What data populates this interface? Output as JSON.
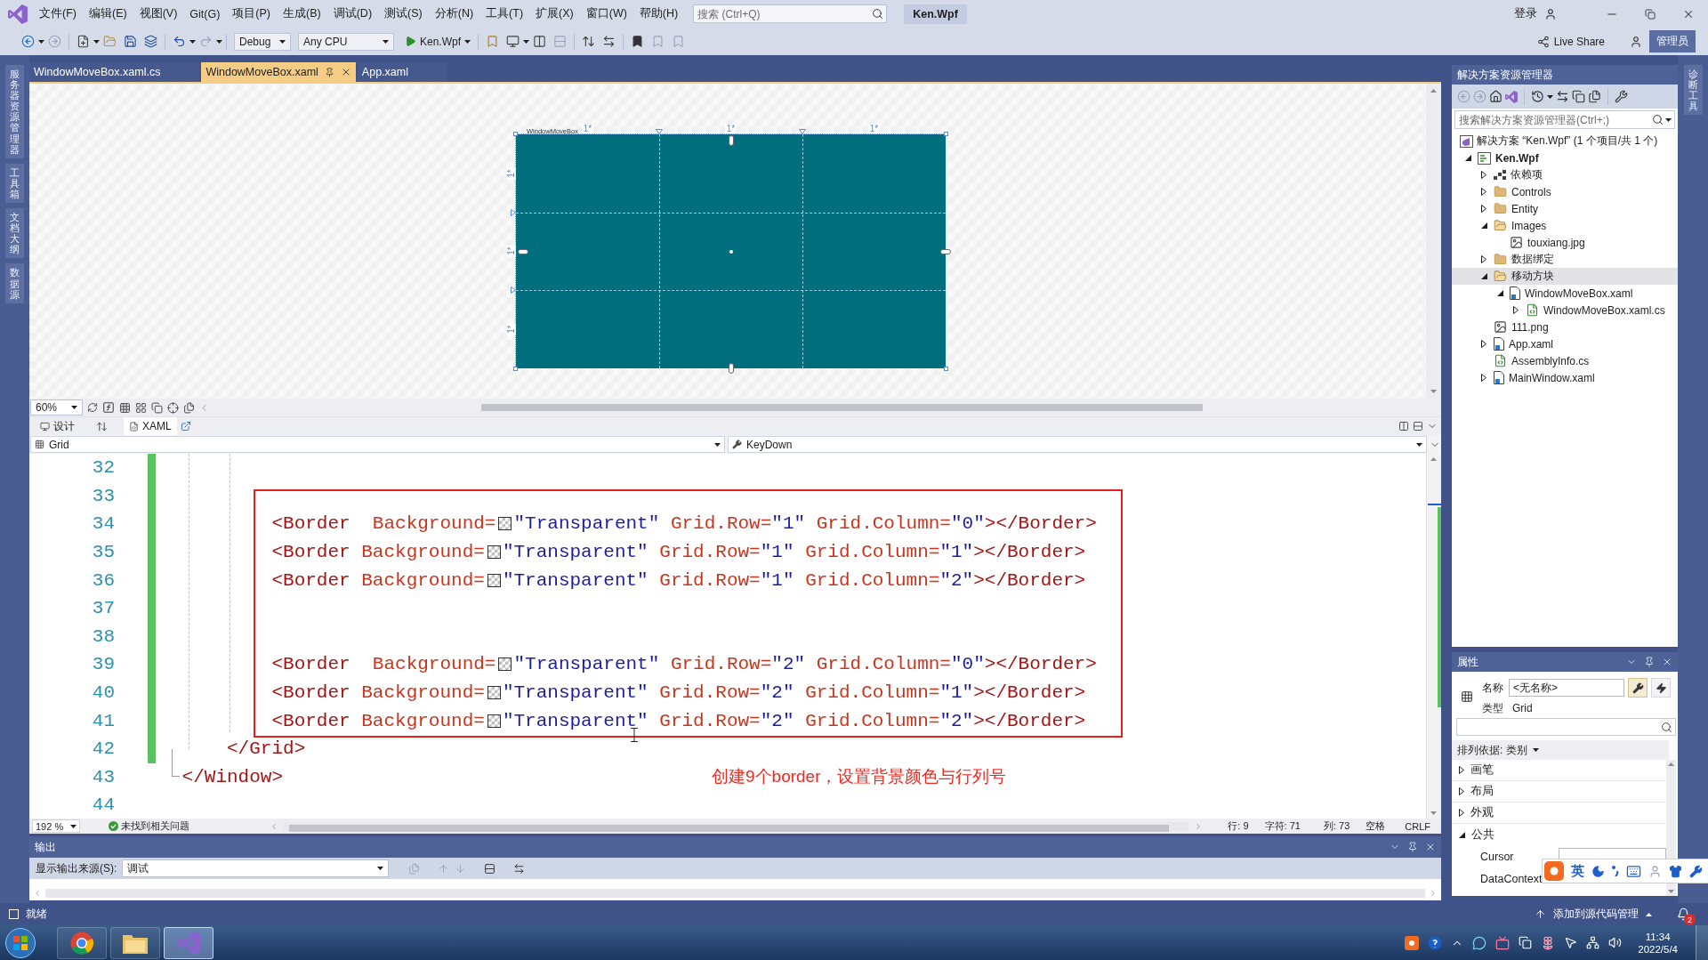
{
  "title_bar": {
    "menus": [
      "文件(F)",
      "编辑(E)",
      "视图(V)",
      "Git(G)",
      "项目(P)",
      "生成(B)",
      "调试(D)",
      "测试(S)",
      "分析(N)",
      "工具(T)",
      "扩展(X)",
      "窗口(W)",
      "帮助(H)"
    ],
    "search": {
      "placeholder": "搜索 (Ctrl+Q)"
    },
    "solution_name": "Ken.Wpf",
    "account": "登录"
  },
  "toolbar": {
    "configuration": "Debug",
    "platform": "Any CPU",
    "start_target": "Ken.Wpf",
    "live_share": "Live Share",
    "role_badge": "管理员"
  },
  "left_tool_tabs": [
    "服务器资源管理器",
    "工具箱",
    "文档大纲",
    "数据源"
  ],
  "right_tool_tabs": [
    "诊断工具"
  ],
  "document_tabs": [
    {
      "label": "WindowMoveBox.xaml.cs",
      "selected": false
    },
    {
      "label": "WindowMoveBox.xaml",
      "selected": true
    },
    {
      "label": "App.xaml",
      "selected": false
    }
  ],
  "designer": {
    "window_label": "WindowMoveBox",
    "columns": [
      "1*",
      "1*",
      "1*"
    ],
    "rows": [
      "1*",
      "1*",
      "1*"
    ],
    "zoom": "60%"
  },
  "view_tabs": [
    {
      "label": "设计",
      "selected": false
    },
    {
      "label": "XAML",
      "selected": true
    }
  ],
  "navigation": {
    "element": "Grid",
    "member": "KeyDown"
  },
  "editor": {
    "blocks": [
      {
        "kind": "changed",
        "children": [
          {
            "kind": "line",
            "number": "32"
          },
          {
            "kind": "line",
            "number": "33"
          },
          {
            "kind": "framed",
            "children": [
              {
                "kind": "line",
                "number": "34",
                "tokens": [
                  {
                    "kind": "tag",
                    "text": "         <Border"
                  },
                  {
                    "kind": "attr",
                    "text": "  Background="
                  },
                  {
                    "kind": "swatch"
                  },
                  {
                    "kind": "value",
                    "text": "\"Transparent\""
                  },
                  {
                    "kind": "attr",
                    "text": " Grid.Row="
                  },
                  {
                    "kind": "value",
                    "text": "\"1\""
                  },
                  {
                    "kind": "attr",
                    "text": " Grid.Column="
                  },
                  {
                    "kind": "value",
                    "text": "\"0\""
                  },
                  {
                    "kind": "tag",
                    "text": "></Border>"
                  }
                ]
              },
              {
                "kind": "line",
                "number": "35",
                "tokens": [
                  {
                    "kind": "tag",
                    "text": "         <Border"
                  },
                  {
                    "kind": "attr",
                    "text": " Background="
                  },
                  {
                    "kind": "swatch"
                  },
                  {
                    "kind": "value",
                    "text": "\"Transparent\""
                  },
                  {
                    "kind": "attr",
                    "text": " Grid.Row="
                  },
                  {
                    "kind": "value",
                    "text": "\"1\""
                  },
                  {
                    "kind": "attr",
                    "text": " Grid.Column="
                  },
                  {
                    "kind": "value",
                    "text": "\"1\""
                  },
                  {
                    "kind": "tag",
                    "text": "></Border>"
                  }
                ]
              },
              {
                "kind": "line",
                "number": "36",
                "tokens": [
                  {
                    "kind": "tag",
                    "text": "         <Border"
                  },
                  {
                    "kind": "attr",
                    "text": " Background="
                  },
                  {
                    "kind": "swatch"
                  },
                  {
                    "kind": "value",
                    "text": "\"Transparent\""
                  },
                  {
                    "kind": "attr",
                    "text": " Grid.Row="
                  },
                  {
                    "kind": "value",
                    "text": "\"1\""
                  },
                  {
                    "kind": "attr",
                    "text": " Grid.Column="
                  },
                  {
                    "kind": "value",
                    "text": "\"2\""
                  },
                  {
                    "kind": "tag",
                    "text": "></Border>"
                  }
                ]
              },
              {
                "kind": "line",
                "number": "37"
              },
              {
                "kind": "line",
                "number": "38"
              },
              {
                "kind": "line",
                "number": "39",
                "tokens": [
                  {
                    "kind": "tag",
                    "text": "         <Border"
                  },
                  {
                    "kind": "attr",
                    "text": "  Background="
                  },
                  {
                    "kind": "swatch"
                  },
                  {
                    "kind": "value",
                    "text": "\"Transparent\""
                  },
                  {
                    "kind": "attr",
                    "text": " Grid.Row="
                  },
                  {
                    "kind": "value",
                    "text": "\"2\""
                  },
                  {
                    "kind": "attr",
                    "text": " Grid.Column="
                  },
                  {
                    "kind": "value",
                    "text": "\"0\""
                  },
                  {
                    "kind": "tag",
                    "text": "></Border>"
                  }
                ]
              },
              {
                "kind": "line",
                "number": "40",
                "tokens": [
                  {
                    "kind": "tag",
                    "text": "         <Border"
                  },
                  {
                    "kind": "attr",
                    "text": " Background="
                  },
                  {
                    "kind": "swatch"
                  },
                  {
                    "kind": "value",
                    "text": "\"Transparent\""
                  },
                  {
                    "kind": "attr",
                    "text": " Grid.Row="
                  },
                  {
                    "kind": "value",
                    "text": "\"2\""
                  },
                  {
                    "kind": "attr",
                    "text": " Grid.Column="
                  },
                  {
                    "kind": "value",
                    "text": "\"1\""
                  },
                  {
                    "kind": "tag",
                    "text": "></Border>"
                  }
                ]
              },
              {
                "kind": "line",
                "number": "41",
                "tokens": [
                  {
                    "kind": "tag",
                    "text": "         <Border"
                  },
                  {
                    "kind": "attr",
                    "text": " Background="
                  },
                  {
                    "kind": "swatch"
                  },
                  {
                    "kind": "value",
                    "text": "\"Transparent\""
                  },
                  {
                    "kind": "attr",
                    "text": " Grid.Row="
                  },
                  {
                    "kind": "value",
                    "text": "\"2\""
                  },
                  {
                    "kind": "attr",
                    "text": " Grid.Column="
                  },
                  {
                    "kind": "value",
                    "text": "\"2\""
                  },
                  {
                    "kind": "tag",
                    "text": "></Border>"
                  }
                ]
              }
            ]
          },
          {
            "kind": "line",
            "number": "42",
            "tokens": [
              {
                "kind": "tag",
                "text": "     </Grid>"
              }
            ]
          }
        ]
      },
      {
        "kind": "line",
        "number": "43",
        "tokens": [
          {
            "kind": "tag",
            "text": " </Window>"
          }
        ],
        "note": "创建9个border，设置背景颜色与行列号"
      },
      {
        "kind": "line",
        "number": "44"
      }
    ]
  },
  "editor_status": {
    "zoom": "192 %",
    "issues": "未找到相关问题",
    "position": [
      "行: 9",
      "字符: 71",
      "列: 73"
    ],
    "indentation": "空格",
    "line_ending": "CRLF"
  },
  "output": {
    "title": "输出",
    "source_label": "显示输出来源(S):",
    "source": "调试"
  },
  "solution_explorer": {
    "title": "解决方案资源管理器",
    "search": {
      "placeholder": "搜索解决方案资源管理器(Ctrl+;)"
    },
    "solution": "解决方案 “Ken.Wpf” (1 个项目/共 1 个)",
    "tree": [
      {
        "label": "Ken.Wpf",
        "kind": "project",
        "expanded": true,
        "selected": false,
        "children": [
          {
            "label": "依赖项",
            "kind": "dependencies",
            "expanded": false,
            "selected": false
          },
          {
            "label": "Controls",
            "kind": "folder",
            "expanded": false,
            "selected": false
          },
          {
            "label": "Entity",
            "kind": "folder",
            "expanded": false,
            "selected": false
          },
          {
            "label": "Images",
            "kind": "folder",
            "expanded": true,
            "selected": false,
            "children": [
              {
                "label": "touxiang.jpg",
                "kind": "image",
                "selected": false
              }
            ]
          },
          {
            "label": "数据绑定",
            "kind": "folder",
            "expanded": false,
            "selected": false
          },
          {
            "label": "移动方块",
            "kind": "folder",
            "expanded": true,
            "selected": true,
            "children": [
              {
                "label": "WindowMoveBox.xaml",
                "kind": "xaml",
                "expanded": true,
                "selected": false,
                "children": [
                  {
                    "label": "WindowMoveBox.xaml.cs",
                    "kind": "csharp",
                    "expanded": false,
                    "selected": false
                  }
                ]
              }
            ]
          },
          {
            "label": "111.png",
            "kind": "image",
            "selected": false
          },
          {
            "label": "App.xaml",
            "kind": "xaml",
            "expanded": false,
            "selected": false
          },
          {
            "label": "AssemblyInfo.cs",
            "kind": "csharp",
            "selected": false
          },
          {
            "label": "MainWindow.xaml",
            "kind": "xaml",
            "expanded": false,
            "selected": false
          }
        ]
      }
    ]
  },
  "properties": {
    "title": "属性",
    "name_label": "名称",
    "name_field": {
      "value": "<无名称>"
    },
    "view_buttons": [
      {
        "kind": "properties",
        "selected": true
      },
      {
        "kind": "events",
        "selected": false
      }
    ],
    "type_label": "类型",
    "type_value": "Grid",
    "sort_label": "排列依据: 类别",
    "categories": [
      {
        "label": "画笔",
        "expanded": false
      },
      {
        "label": "布局",
        "expanded": false
      },
      {
        "label": "外观",
        "expanded": false
      },
      {
        "label": "公共",
        "expanded": true,
        "items": [
          {
            "label": "Cursor",
            "kind": "dropdown"
          },
          {
            "label": "DataContext",
            "kind": "text"
          }
        ]
      }
    ]
  },
  "ime_bar": {
    "mode": "英"
  },
  "status_bar": {
    "text": "就绪",
    "source_control": "添加到源代码管理",
    "notifications": "2"
  },
  "taskbar": {
    "apps": [
      {
        "kind": "browser",
        "selected": false
      },
      {
        "kind": "files",
        "selected": false
      },
      {
        "kind": "ide",
        "selected": true
      }
    ],
    "time": "11:34",
    "date": "2022/5/4"
  }
}
